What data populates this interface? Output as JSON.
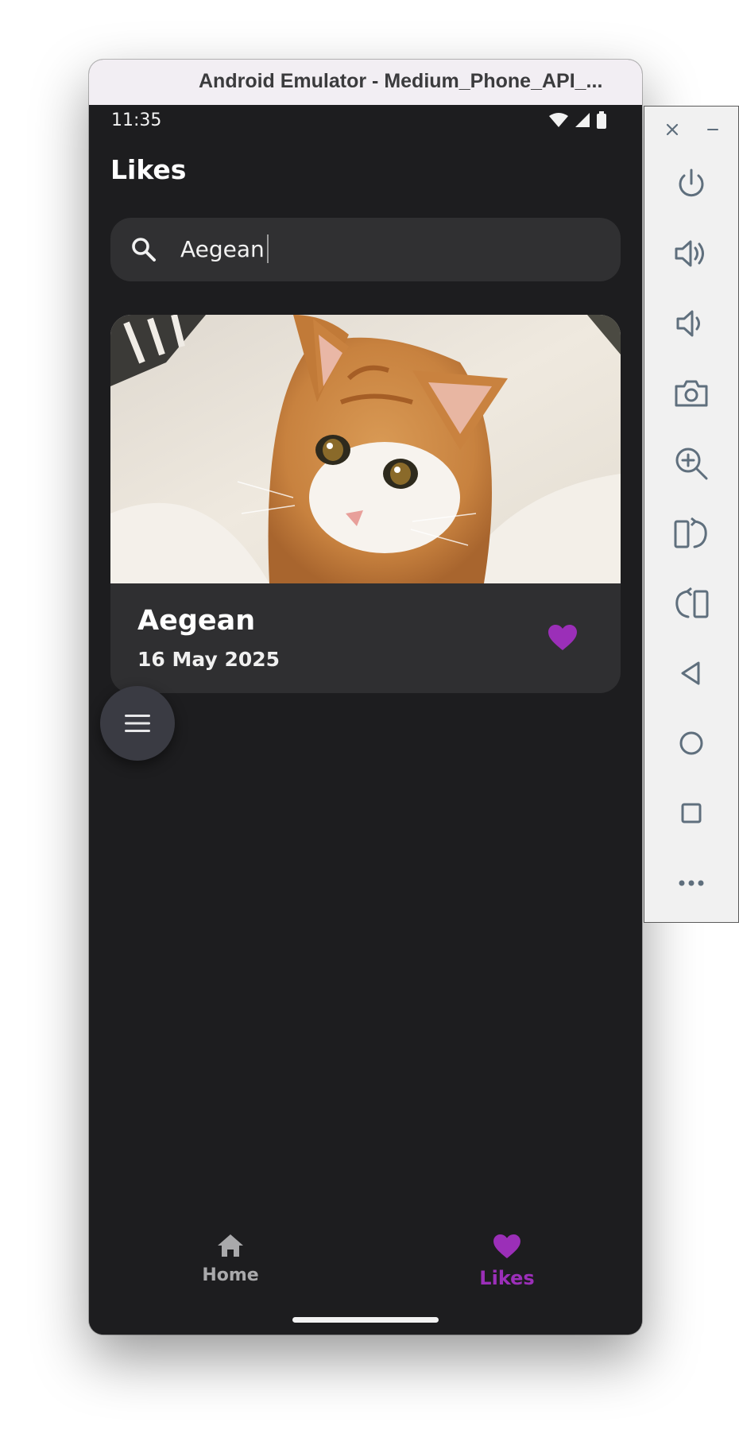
{
  "window": {
    "title": "Android Emulator - Medium_Phone_API_..."
  },
  "status_bar": {
    "time": "11:35"
  },
  "page": {
    "title": "Likes"
  },
  "search": {
    "value": "Aegean"
  },
  "card": {
    "title": "Aegean",
    "date": "16 May 2025",
    "liked": true
  },
  "nav": {
    "home_label": "Home",
    "likes_label": "Likes",
    "active": "Likes"
  },
  "colors": {
    "accent": "#9b2fb8",
    "background": "#1d1d1f",
    "surface": "#303032"
  },
  "side_panel": {
    "buttons": [
      "close-icon",
      "minimize-icon",
      "power-icon",
      "volume-up-icon",
      "volume-down-icon",
      "camera-icon",
      "zoom-icon",
      "rotate-left-icon",
      "rotate-right-icon",
      "back-icon",
      "home-icon",
      "overview-icon",
      "more-icon"
    ]
  }
}
